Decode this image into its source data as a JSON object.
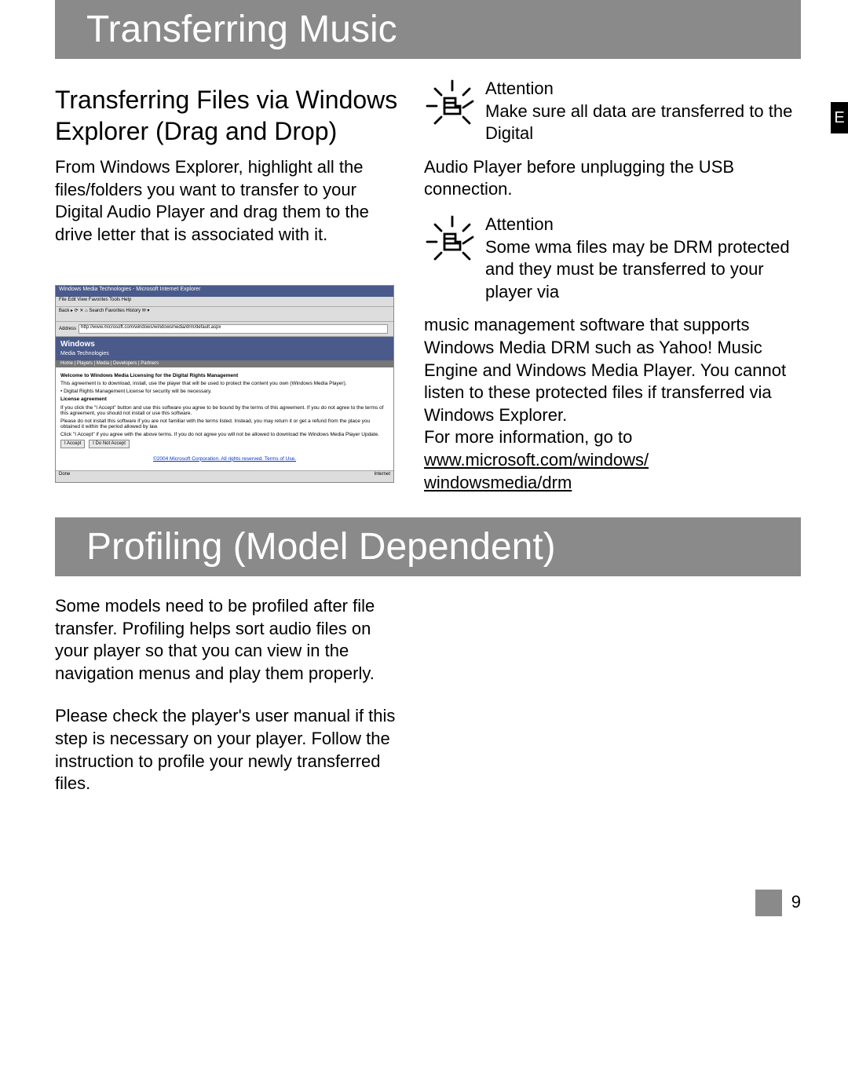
{
  "edge_tab": "E",
  "section1": {
    "header": "Transferring Music",
    "subheader": "Transferring Files via Windows Explorer (Drag and Drop)",
    "body": "From Windows Explorer, highlight all the files/folders you want to transfer to your Digital Audio Player and drag them to the drive letter that is associated with it.",
    "screenshot": {
      "title": "Windows Media Technologies - Microsoft Internet Explorer",
      "menu": "File   Edit   View   Favorites   Tools   Help",
      "toolbar": "Back  ▸  ⟳  ✕  ⌂  Search  Favorites  History  ✉ ▾",
      "address_label": "Address",
      "address_value": "http://www.microsoft.com/windows/windowsmedia/drm/default.aspx",
      "banner": "Windows",
      "banner_sub": "Media Technologies",
      "tabs": "Home | Players | Media | Developers | Partners",
      "c1": "Welcome to Windows Media Licensing for the Digital Rights Management",
      "c2": "This agreement is to download, install, use the player that will be used to protect the content you own (Windows Media Player).",
      "c3": "• Digital Rights Management License for security will be necessary.",
      "c4": "License agreement",
      "c5": "If you click the \"I Accept\" button and use this software you agree to be bound by the terms of this agreement. If you do not agree to the terms of this agreement, you should not install or use this software.",
      "c6": "Please do not install this software if you are not familiar with the terms listed. Instead, you may return it or get a refund from the place you obtained it within the period allowed by law.",
      "c7": "Click \"I Accept\" if you agree with the above terms. If you do not agree you will not be allowed to download the Windows Media Player Update.",
      "btn1": "I Accept",
      "btn2": "I Do Not Accept",
      "footer_link": "©2004 Microsoft Corporation. All rights reserved. Terms of Use.",
      "status_left": "Done",
      "status_right": "Internet"
    },
    "attention1": {
      "label": "Attention",
      "text_inline": "Make sure all data are transferred to the Digital",
      "text_below": "Audio Player before unplugging the USB connection."
    },
    "attention2": {
      "label": "Attention",
      "text_inline": "Some wma files may be DRM protected and they must be transferred to your player via",
      "text_below1": "music management software that supports Windows Media DRM such as Yahoo! Music Engine and Windows Media Player. You cannot listen to these protected files if transferred via Windows Explorer.",
      "text_below2": "For more information, go to ",
      "link": "www.microsoft.com/windows/ windowsmedia/drm"
    }
  },
  "section2": {
    "header": "Profiling (Model Dependent)",
    "body1": "Some models need to be profiled after file transfer. Profiling helps sort audio files on your player so that you can view in the navigation menus and play them properly.",
    "body2": "Please check the player's user manual if this step is necessary on your player. Follow the instruction to profile your newly transferred files."
  },
  "page_number": "9"
}
